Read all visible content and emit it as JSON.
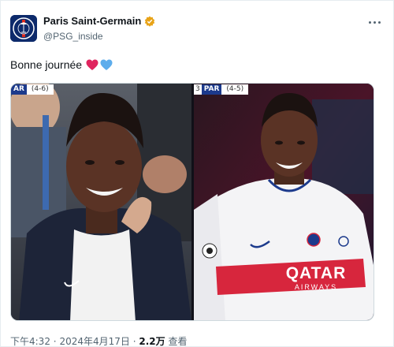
{
  "account": {
    "display_name": "Paris Saint-Germain",
    "handle": "@PSG_inside",
    "avatar_icon": "psg-crest-icon",
    "verified_color": "#e8a317"
  },
  "tweet": {
    "text": "Bonne journée",
    "emojis": [
      "red-heart-icon",
      "blue-heart-icon"
    ]
  },
  "media": {
    "left_photo": {
      "team_label": "AR",
      "aggregate": "(4-6)"
    },
    "right_photo": {
      "prefix": "3",
      "team_label": "PAR",
      "aggregate": "(4-5)",
      "sponsor": "QATAR",
      "sponsor_sub": "AIRWAYS"
    }
  },
  "footer": {
    "time": "下午4:32",
    "date": "2024年4月17日",
    "views_count": "2.2万",
    "views_label": "查看",
    "separator": "·"
  },
  "colors": {
    "accent_blue": "#1c3a8c",
    "text_primary": "#0f1419",
    "text_secondary": "#536471"
  }
}
